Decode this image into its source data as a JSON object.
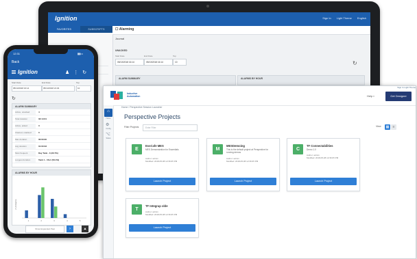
{
  "tablet": {
    "logo": "Ignition",
    "top_right": [
      "Sign In",
      "Light Theme",
      "English"
    ],
    "tabs": [
      "FAVORITES",
      "SUBSCRIPTS"
    ],
    "home_label": "HOME",
    "alarm_header": "Alarming",
    "journal_label": "Journal",
    "unacked_label": "UNACKED",
    "start_label": "Start Date",
    "end_label": "End Date",
    "top_label": "Top",
    "start_value": "05/13/2018 16:14",
    "end_value": "05/13/2018 16:14",
    "top_value": "10",
    "alarm_summary": "ALARM SUMMARY",
    "alarms_by_hour": "ALARMS BY HOUR"
  },
  "window": {
    "top_strip": "Sign In   Light Theme",
    "logo_text": [
      "Inductive",
      "Automation"
    ],
    "help": "Help",
    "cta": "Get Designer",
    "breadcrumb": "Home  /  Perspective Session Launcher",
    "nav": [
      {
        "icon": "⌂",
        "label": "Home"
      },
      {
        "icon": "⚙",
        "label": "Config"
      },
      {
        "icon": "⌥",
        "label": "Status"
      }
    ],
    "title": "Perspective Projects",
    "filter_label": "Filter Projects",
    "filter_placeholder": "Enter Filter",
    "view_label": "View",
    "cards": [
      {
        "letter": "E",
        "title": "EssCafe MES",
        "desc": "MES Demonstration for Essentials",
        "author": "Author: admin",
        "modified": "Modified: 2018-05-08 12:36:05 PM",
        "button": "Launch Project"
      },
      {
        "letter": "M",
        "title": "MESDemoing",
        "desc": "This is the default project at Perspective for running demos",
        "author": "Author: admin",
        "modified": "Modified: 2018-05-08 12:36:05 PM",
        "button": "Launch Project"
      },
      {
        "letter": "C",
        "title": "TF Connectabilities",
        "desc": "Demo 1.0",
        "author": "Author: admin",
        "modified": "Modified: 2018-05-08 12:36:05 PM",
        "button": "Launch Project"
      },
      {
        "letter": "T",
        "title": "TF Integrap olde",
        "desc": "",
        "author": "Author: admin",
        "modified": "Modified: 2018-05-08 12:36:05 PM",
        "button": "Launch Project"
      }
    ]
  },
  "phone": {
    "status_time": "12:31",
    "back_label": "Back",
    "logo": "Ignition",
    "header_icons": [
      "♟",
      "⋮",
      "↻"
    ],
    "start_label": "Start Date",
    "end_label": "End Date",
    "top_label": "Top",
    "start_value": "05/13/2018 16:14",
    "end_value": "05/13/2018 21:04",
    "top_value": "10",
    "summary_header": "ALARM SUMMARY",
    "summary_rows": [
      {
        "k": "Active, unacked",
        "v": "4"
      },
      {
        "k": "Total duration",
        "v": "02:14:01"
      },
      {
        "k": "Active, acked",
        "v": "3"
      },
      {
        "k": "Cleared, unacked",
        "v": "0"
      },
      {
        "k": "Max duration",
        "v": "00:00:00"
      },
      {
        "k": "Avg duration",
        "v": "01:00:33"
      },
      {
        "k": "Most frequent",
        "v": "Day Tank - 3 (30.7%)"
      },
      {
        "k": "Longest duration",
        "v": "Tank 1 - 15o1 (53.4%)"
      }
    ],
    "chart_header": "ALARMS BY HOUR",
    "bottom_field": "Show Expanded Past"
  },
  "chart_data": {
    "type": "bar",
    "title": "ALARMS BY HOUR",
    "ylabel": "# of Alarms",
    "categories": [
      "1",
      "2",
      "3",
      "4",
      "5"
    ],
    "series": [
      {
        "color": "#2c5fa8",
        "values": [
          2,
          6,
          5,
          1,
          0
        ]
      },
      {
        "color": "#6cc56c",
        "values": [
          0,
          8,
          3,
          0,
          0
        ]
      }
    ],
    "ylim": [
      0,
      10
    ]
  },
  "colors": {
    "brand_blue": "#1d5fae",
    "button_blue": "#2f7fd6",
    "card_green": "#4caf68",
    "cta_navy": "#243b74"
  }
}
